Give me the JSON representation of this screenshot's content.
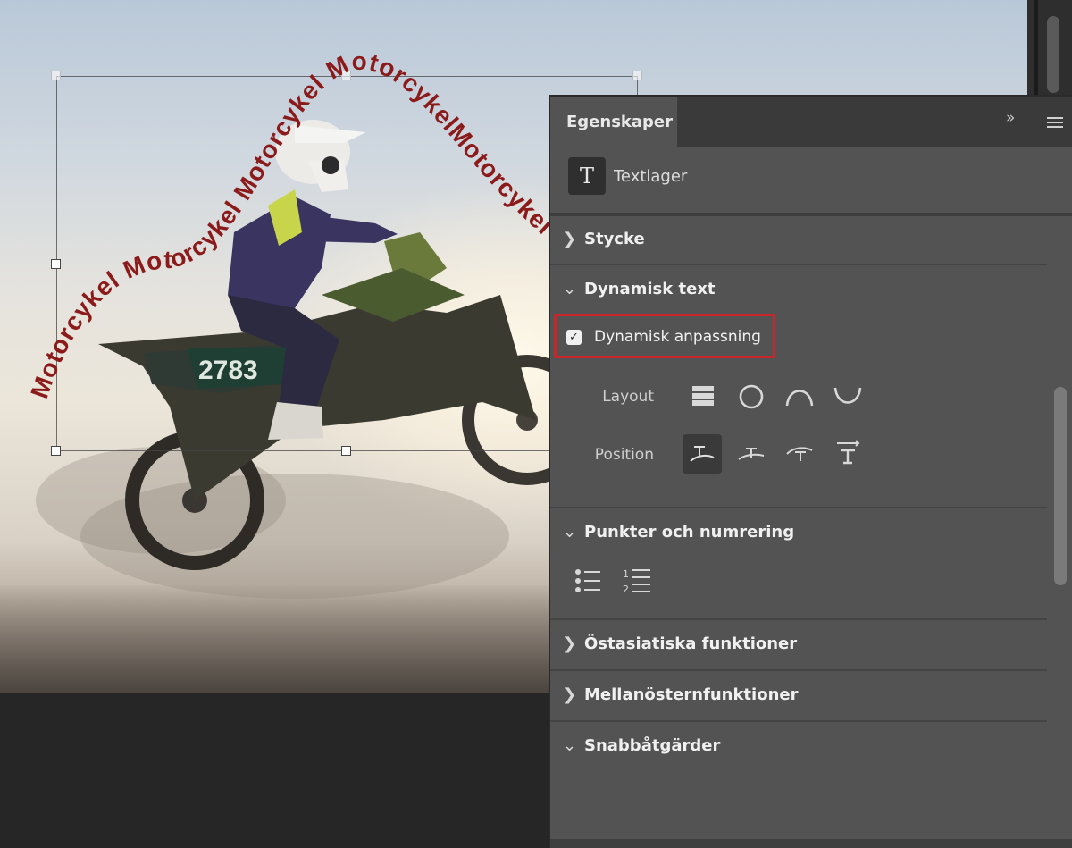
{
  "canvas": {
    "curved_text": "Motorcykel Motorcykel Motorcykel MotorcykelMotorcykel Motorcykel",
    "text_color": "#8b1a1a",
    "bike_number": "2783"
  },
  "panel": {
    "tab_label": "Egenskaper",
    "collapse_icon": "»",
    "layer_type_icon": "T",
    "layer_type_label": "Textlager",
    "sections": {
      "stycke": "Stycke",
      "dynamisk_text": "Dynamisk text",
      "punkter": "Punkter och numrering",
      "ostasiatiska": "Östasiatiska funktioner",
      "mellanostern": "Mellanösternfunktioner",
      "snabbatgarder": "Snabbåtgärder"
    },
    "dynamic_fit": {
      "label": "Dynamisk anpassning",
      "checked": true,
      "highlight_color": "#c8262b"
    },
    "layout_label": "Layout",
    "position_label": "Position",
    "icons": {
      "layout": [
        "rectangle-layout-icon",
        "circle-layout-icon",
        "arch-up-layout-icon",
        "arch-down-layout-icon"
      ],
      "position": [
        "text-on-curve-icon",
        "text-above-path-icon",
        "text-on-arc-icon",
        "text-stretch-icon"
      ],
      "lists": [
        "bulleted-list-icon",
        "numbered-list-icon"
      ]
    }
  }
}
